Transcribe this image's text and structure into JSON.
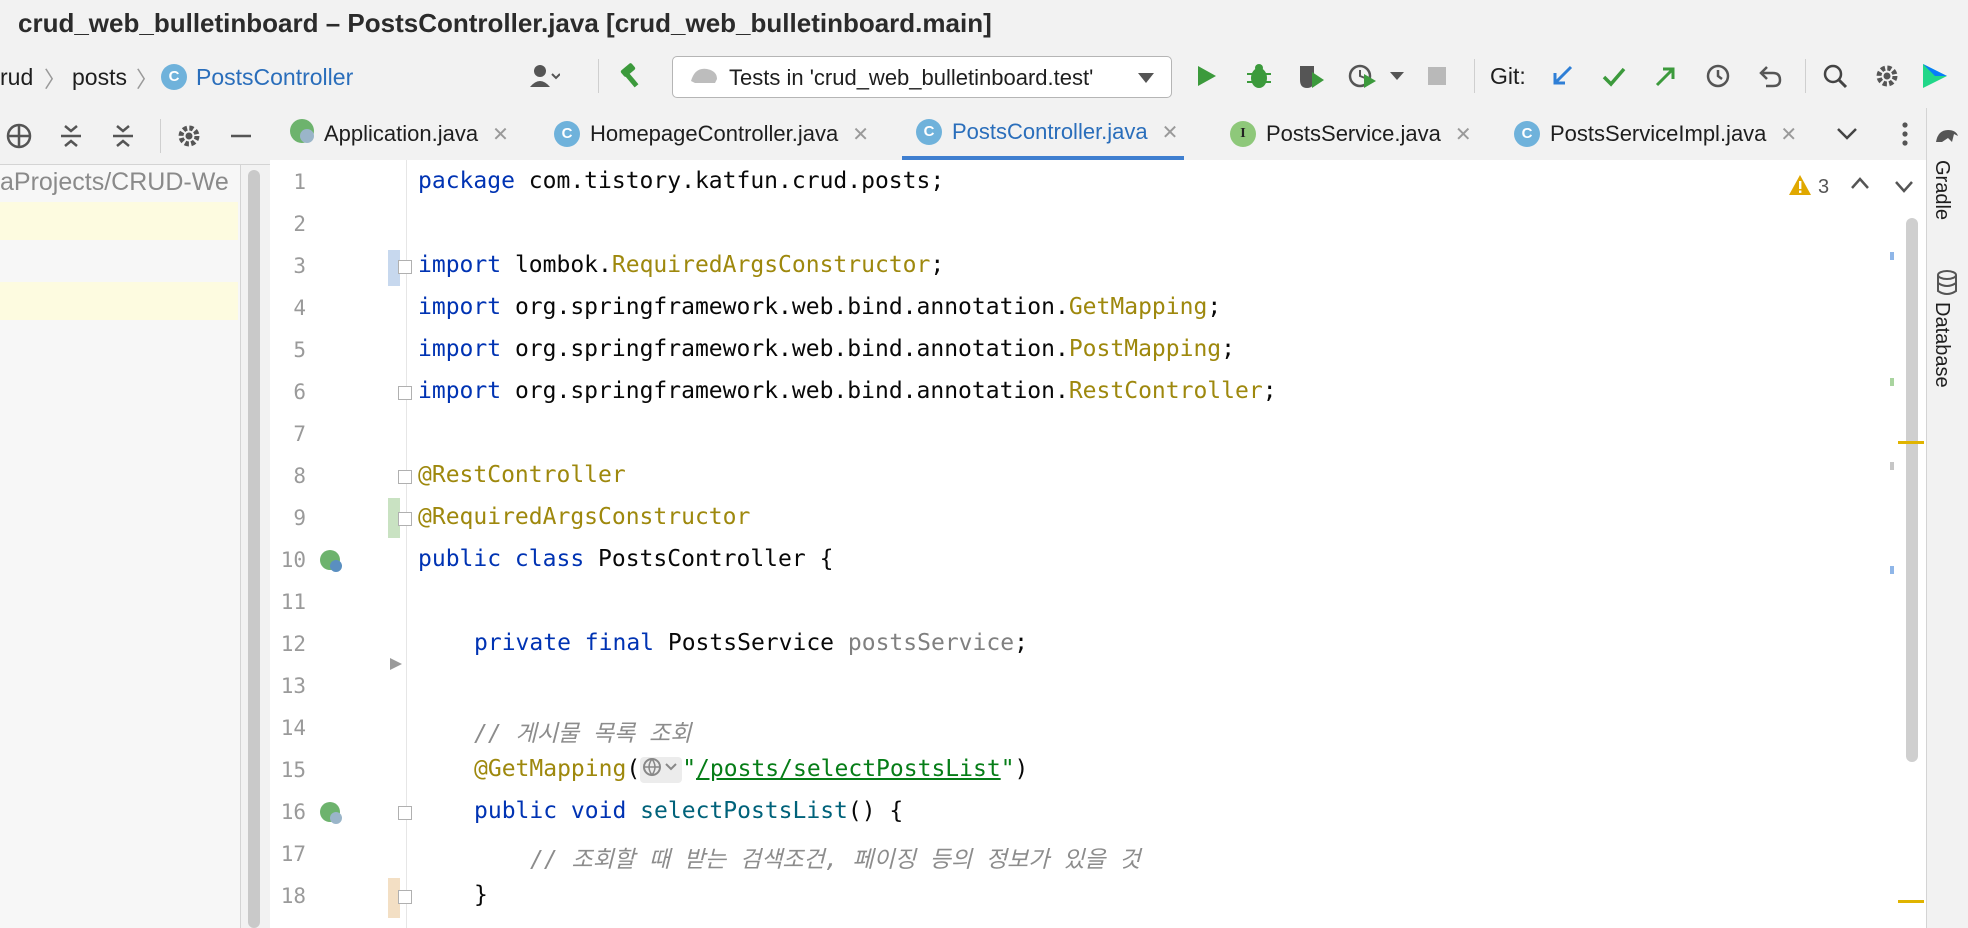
{
  "window": {
    "title": "crud_web_bulletinboard – PostsController.java [crud_web_bulletinboard.main]"
  },
  "breadcrumb": [
    {
      "label": "rud"
    },
    {
      "label": "posts"
    },
    {
      "label": "PostsController",
      "badge": "C"
    }
  ],
  "toolbar": {
    "run_config": "Tests in 'crud_web_bulletinboard.test'",
    "git_label": "Git:"
  },
  "project_panel": {
    "path": "aProjects/CRUD-We"
  },
  "tabs": [
    {
      "label": "Application.java",
      "badge": "",
      "active": false
    },
    {
      "label": "HomepageController.java",
      "badge": "C",
      "active": false
    },
    {
      "label": "PostsController.java",
      "badge": "C",
      "active": true
    },
    {
      "label": "PostsService.java",
      "badge": "I",
      "active": false
    },
    {
      "label": "PostsServiceImpl.java",
      "badge": "C",
      "active": false
    }
  ],
  "inspection": {
    "warnings": "3"
  },
  "right_tools": {
    "gradle": "Gradle",
    "database": "Database"
  },
  "code": {
    "line_numbers": [
      "1",
      "2",
      "3",
      "4",
      "5",
      "6",
      "7",
      "8",
      "9",
      "10",
      "11",
      "12",
      "13",
      "14",
      "15",
      "16",
      "17",
      "18"
    ],
    "l1_kw": "package",
    "l1_rest": " com.tistory.katfun.crud.posts;",
    "import_kw": "import",
    "l3_pkg": " lombok.",
    "l3_cls": "RequiredArgsConstructor",
    "semi": ";",
    "l4_pkg": " org.springframework.web.bind.annotation.",
    "l4_cls": "GetMapping",
    "l5_pkg": " org.springframework.web.bind.annotation.",
    "l5_cls": "PostMapping",
    "l6_pkg": " org.springframework.web.bind.annotation.",
    "l6_cls": "RestController",
    "l8": "@RestController",
    "l9": "@RequiredArgsConstructor",
    "l10_kw": "public class",
    "l10_rest": " PostsController {",
    "l12_kw": "private final",
    "l12_type": " PostsService ",
    "l12_field": "postsService",
    "l12_end": ";",
    "l14": "// 게시물 목록 조회",
    "l15_ann": "@GetMapping",
    "l15_open": "(",
    "l15_str": "/posts/selectPostsList",
    "l15_q": "\"",
    "l15_close": ")",
    "l16_kw": "public void",
    "l16_fn": " selectPostsList",
    "l16_rest": "() {",
    "l17": "// 조회할 때 받는 검색조건, 페이징 등의 정보가 있을 것",
    "l18": "}"
  },
  "colors": {
    "accent": "#3f7fd0",
    "keyword": "#0033b3",
    "annotation": "#9e880d",
    "comment": "#8c8c8c"
  }
}
